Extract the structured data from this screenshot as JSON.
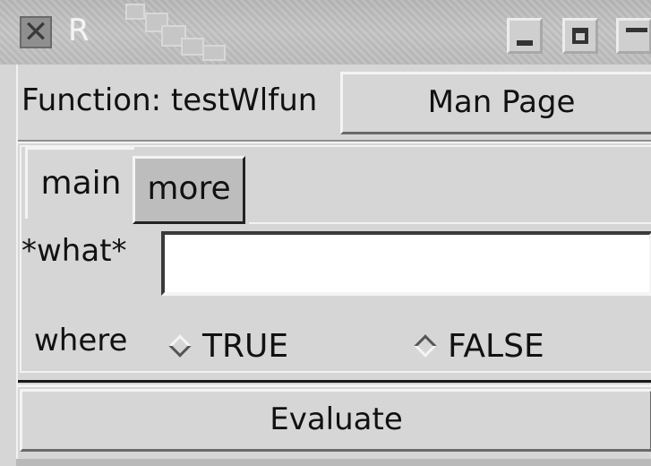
{
  "window": {
    "title": "R",
    "controls": {
      "close_icon": "close-icon",
      "minimize_icon": "minimize-icon",
      "maximize_icon": "maximize-icon"
    }
  },
  "header": {
    "function_label": "Function: testWlfun",
    "man_page_label": "Man Page"
  },
  "tabs": [
    {
      "label": "main",
      "selected": true
    },
    {
      "label": "more",
      "selected": false
    }
  ],
  "form": {
    "what": {
      "label": "*what*",
      "value": "",
      "placeholder": ""
    },
    "where": {
      "label": "where",
      "options": [
        {
          "label": "TRUE",
          "selected": false
        },
        {
          "label": "FALSE",
          "selected": true
        }
      ]
    }
  },
  "footer": {
    "evaluate_label": "Evaluate"
  },
  "colors": {
    "window_bg": "#d6d6d6",
    "tab_inactive_bg": "#bdbdbd",
    "input_bg": "#ffffff"
  }
}
